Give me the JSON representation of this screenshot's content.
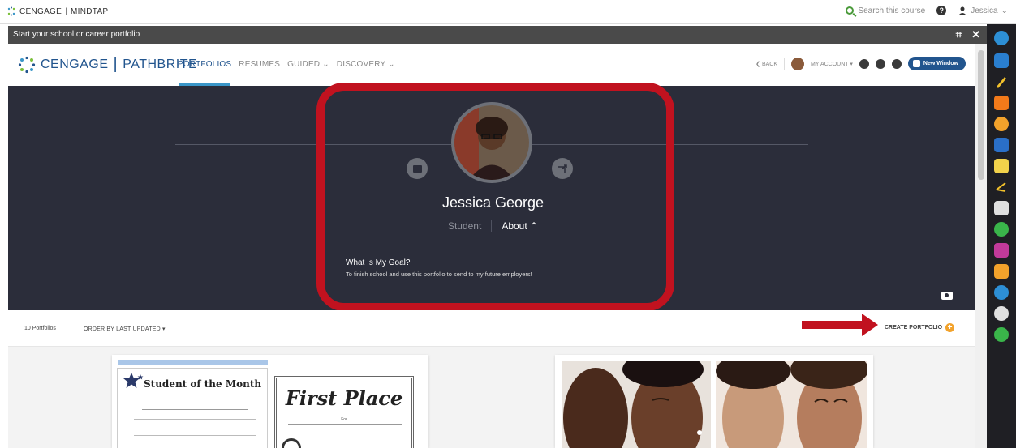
{
  "topbar": {
    "brand_left": "CENGAGE",
    "brand_sep": "|",
    "brand_right": "MINDTAP",
    "search_label": "Search this course",
    "help_label": "?",
    "user_name": "Jessica",
    "user_caret": "⌄"
  },
  "window": {
    "title": "Start your school or career portfolio",
    "expand_label": "⌗",
    "close_label": "✕"
  },
  "app": {
    "logo_left": "CENGAGE",
    "logo_sep": "|",
    "logo_right": "PATHBRITE",
    "tabs": [
      {
        "label": "PORTFOLIOS"
      },
      {
        "label": "RESUMES"
      },
      {
        "label": "GUIDED ⌄"
      },
      {
        "label": "DISCOVERY ⌄"
      }
    ],
    "back_label": "❮ BACK",
    "account_label": "MY ACCOUNT ▾",
    "new_window_label": "New Window"
  },
  "profile": {
    "name": "Jessica George",
    "role": "Student",
    "about_label": "About ⌃",
    "goal_title": "What Is My Goal?",
    "goal_text": "To finish school and use this portfolio to send to my future employers!"
  },
  "toolbar": {
    "count": "10 Portfolios",
    "order": "ORDER BY LAST UPDATED ▾",
    "create": "CREATE PORTFOLIO",
    "create_icon": "+"
  },
  "cards": {
    "cert1_title": "Student of the Month",
    "cert2_title": "First Place",
    "cert2_sub": "For"
  },
  "colors": {
    "accent": "#22558e",
    "highlight_red": "#c1121f",
    "hero_bg": "#2b2d3a",
    "create_plus": "#f2a22b"
  }
}
